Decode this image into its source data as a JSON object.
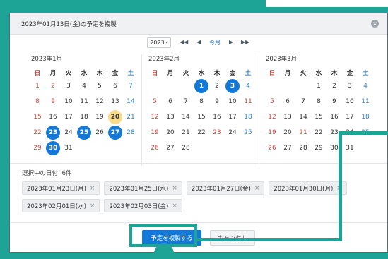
{
  "dialog": {
    "title": "2023年01月13日(金)の予定を複製",
    "close_icon": "×"
  },
  "nav": {
    "year": "2023",
    "year_caret": "▾",
    "prev_year": "◀◀",
    "prev_month": "◀",
    "today": "今月",
    "next_month": "▶",
    "next_year": "▶▶"
  },
  "weekdays": [
    "日",
    "月",
    "火",
    "水",
    "木",
    "金",
    "土"
  ],
  "months": [
    {
      "title": "2023年1月",
      "days": [
        "1",
        "2",
        "3",
        "4",
        "5",
        "6",
        "7",
        "8",
        "9",
        "10",
        "11",
        "12",
        "13",
        "14",
        "15",
        "16",
        "17",
        "18",
        "19",
        "20",
        "21",
        "22",
        "23",
        "24",
        "25",
        "26",
        "27",
        "28",
        "29",
        "30",
        "31"
      ],
      "offset": 0,
      "selected": [
        "23",
        "25",
        "27",
        "30"
      ],
      "today": "20",
      "holidays": [
        "2",
        "9"
      ]
    },
    {
      "title": "2023年2月",
      "days": [
        "1",
        "2",
        "3",
        "4",
        "5",
        "6",
        "7",
        "8",
        "9",
        "10",
        "11",
        "12",
        "13",
        "14",
        "15",
        "16",
        "17",
        "18",
        "19",
        "20",
        "21",
        "22",
        "23",
        "24",
        "25",
        "26",
        "27",
        "28"
      ],
      "offset": 3,
      "selected": [
        "1",
        "3"
      ],
      "today": "",
      "holidays": [
        "11",
        "23"
      ]
    },
    {
      "title": "2023年3月",
      "days": [
        "1",
        "2",
        "3",
        "4",
        "5",
        "6",
        "7",
        "8",
        "9",
        "10",
        "11",
        "12",
        "13",
        "14",
        "15",
        "16",
        "17",
        "18",
        "19",
        "20",
        "21",
        "22",
        "23",
        "24",
        "25",
        "26",
        "27",
        "28",
        "29",
        "30",
        "31"
      ],
      "offset": 3,
      "selected": [],
      "today": "",
      "holidays": [
        "21"
      ]
    }
  ],
  "selection": {
    "count_label": "選択中の日付: 6件",
    "chips": [
      "2023年01月23日(月)",
      "2023年01月25日(水)",
      "2023年01月27日(金)",
      "2023年01月30日(月)",
      "2023年02月01日(水)",
      "2023年02月03日(金)"
    ],
    "remove_icon": "×"
  },
  "footer": {
    "primary_label": "予定を複製する",
    "cancel_label": "キャンセル"
  },
  "colors": {
    "accent": "#1479d6",
    "highlight": "#1ea497",
    "today_bg": "#f8dc8c",
    "sunday": "#d5433a",
    "saturday": "#2c82d4"
  }
}
